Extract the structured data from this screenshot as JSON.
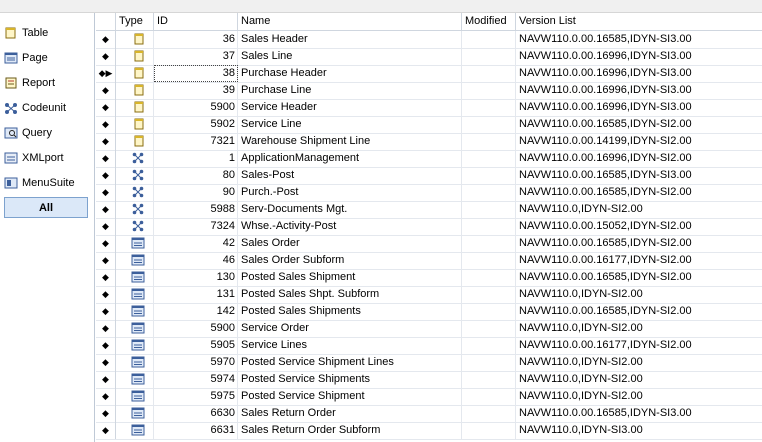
{
  "sidebar": {
    "items": [
      {
        "label": "Table",
        "icon": "table-icon"
      },
      {
        "label": "Page",
        "icon": "page-icon"
      },
      {
        "label": "Report",
        "icon": "report-icon"
      },
      {
        "label": "Codeunit",
        "icon": "codeunit-icon"
      },
      {
        "label": "Query",
        "icon": "query-icon"
      },
      {
        "label": "XMLport",
        "icon": "xmlport-icon"
      },
      {
        "label": "MenuSuite",
        "icon": "menusuite-icon"
      },
      {
        "label": "All",
        "icon": ""
      }
    ],
    "active": "All"
  },
  "grid": {
    "columns": {
      "type": "Type",
      "id": "ID",
      "name": "Name",
      "modified": "Modified",
      "version": "Version List"
    },
    "rows": [
      {
        "type": "table",
        "id": "36",
        "name": "Sales Header",
        "version": "NAVW110.0.00.16585,IDYN-SI3.00"
      },
      {
        "type": "table",
        "id": "37",
        "name": "Sales Line",
        "version": "NAVW110.0.00.16996,IDYN-SI3.00"
      },
      {
        "type": "table",
        "id": "38",
        "name": "Purchase Header",
        "version": "NAVW110.0.00.16996,IDYN-SI3.00",
        "current": true
      },
      {
        "type": "table",
        "id": "39",
        "name": "Purchase Line",
        "version": "NAVW110.0.00.16996,IDYN-SI3.00"
      },
      {
        "type": "table",
        "id": "5900",
        "name": "Service Header",
        "version": "NAVW110.0.00.16996,IDYN-SI3.00"
      },
      {
        "type": "table",
        "id": "5902",
        "name": "Service Line",
        "version": "NAVW110.0.00.16585,IDYN-SI2.00"
      },
      {
        "type": "table",
        "id": "7321",
        "name": "Warehouse Shipment Line",
        "version": "NAVW110.0.00.14199,IDYN-SI2.00"
      },
      {
        "type": "codeunit",
        "id": "1",
        "name": "ApplicationManagement",
        "version": "NAVW110.0.00.16996,IDYN-SI2.00"
      },
      {
        "type": "codeunit",
        "id": "80",
        "name": "Sales-Post",
        "version": "NAVW110.0.00.16585,IDYN-SI3.00"
      },
      {
        "type": "codeunit",
        "id": "90",
        "name": "Purch.-Post",
        "version": "NAVW110.0.00.16585,IDYN-SI2.00"
      },
      {
        "type": "codeunit",
        "id": "5988",
        "name": "Serv-Documents Mgt.",
        "version": "NAVW110.0,IDYN-SI2.00"
      },
      {
        "type": "codeunit",
        "id": "7324",
        "name": "Whse.-Activity-Post",
        "version": "NAVW110.0.00.15052,IDYN-SI2.00"
      },
      {
        "type": "page",
        "id": "42",
        "name": "Sales Order",
        "version": "NAVW110.0.00.16585,IDYN-SI2.00"
      },
      {
        "type": "page",
        "id": "46",
        "name": "Sales Order Subform",
        "version": "NAVW110.0.00.16177,IDYN-SI2.00"
      },
      {
        "type": "page",
        "id": "130",
        "name": "Posted Sales Shipment",
        "version": "NAVW110.0.00.16585,IDYN-SI2.00"
      },
      {
        "type": "page",
        "id": "131",
        "name": "Posted Sales Shpt. Subform",
        "version": "NAVW110.0,IDYN-SI2.00"
      },
      {
        "type": "page",
        "id": "142",
        "name": "Posted Sales Shipments",
        "version": "NAVW110.0.00.16585,IDYN-SI2.00"
      },
      {
        "type": "page",
        "id": "5900",
        "name": "Service Order",
        "version": "NAVW110.0,IDYN-SI2.00"
      },
      {
        "type": "page",
        "id": "5905",
        "name": "Service Lines",
        "version": "NAVW110.0.00.16177,IDYN-SI2.00"
      },
      {
        "type": "page",
        "id": "5970",
        "name": "Posted Service Shipment Lines",
        "version": "NAVW110.0,IDYN-SI2.00"
      },
      {
        "type": "page",
        "id": "5974",
        "name": "Posted Service Shipments",
        "version": "NAVW110.0,IDYN-SI2.00"
      },
      {
        "type": "page",
        "id": "5975",
        "name": "Posted Service Shipment",
        "version": "NAVW110.0,IDYN-SI2.00"
      },
      {
        "type": "page",
        "id": "6630",
        "name": "Sales Return Order",
        "version": "NAVW110.0.00.16585,IDYN-SI3.00"
      },
      {
        "type": "page",
        "id": "6631",
        "name": "Sales Return Order Subform",
        "version": "NAVW110.0,IDYN-SI3.00"
      }
    ]
  }
}
